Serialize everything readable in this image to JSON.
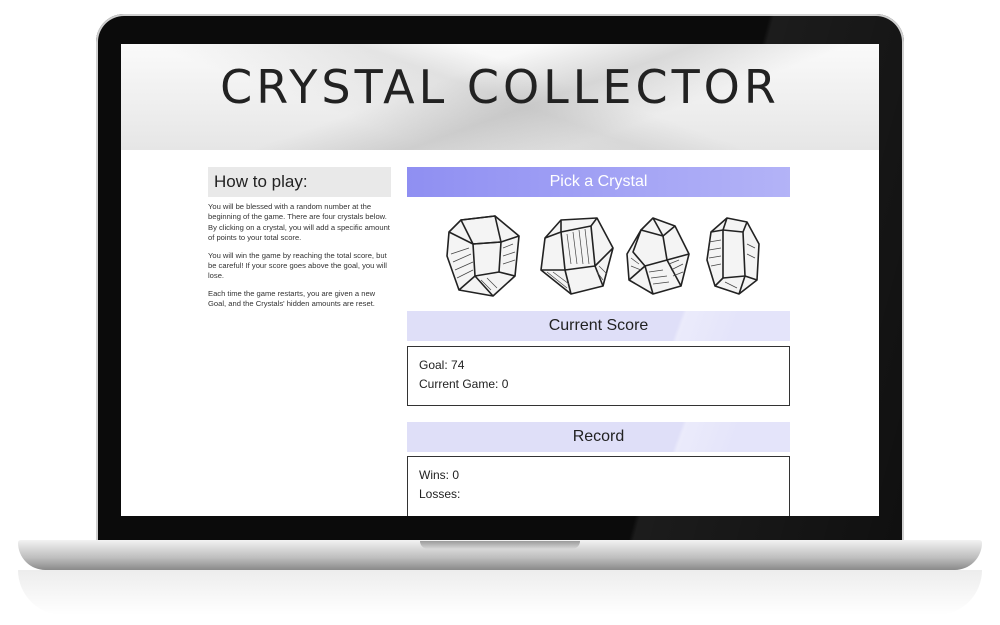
{
  "header": {
    "title": "CRYSTAL COLLECTOR"
  },
  "howto": {
    "heading": "How to play:",
    "paragraphs": [
      "You will be blessed with a random number at the beginning of the game. There are four crystals below. By clicking on a crystal, you will add a specific amount of points to your total score.",
      "You will win the game by reaching the total score, but be careful! If your score goes above the goal, you will lose.",
      "Each time the game restarts, you are given a new Goal, and the Crystals' hidden amounts are reset."
    ]
  },
  "pick": {
    "title": "Pick a Crystal"
  },
  "crystals": [
    "crystal-1",
    "crystal-2",
    "crystal-3",
    "crystal-4"
  ],
  "score": {
    "title": "Current Score",
    "goal_label": "Goal: 74",
    "current_label": "Current Game: 0"
  },
  "record": {
    "title": "Record",
    "wins_label": "Wins: 0",
    "losses_label": "Losses:"
  },
  "colors": {
    "pick_banner": "#8f8ff2",
    "section_banner": "#dfdff8"
  }
}
